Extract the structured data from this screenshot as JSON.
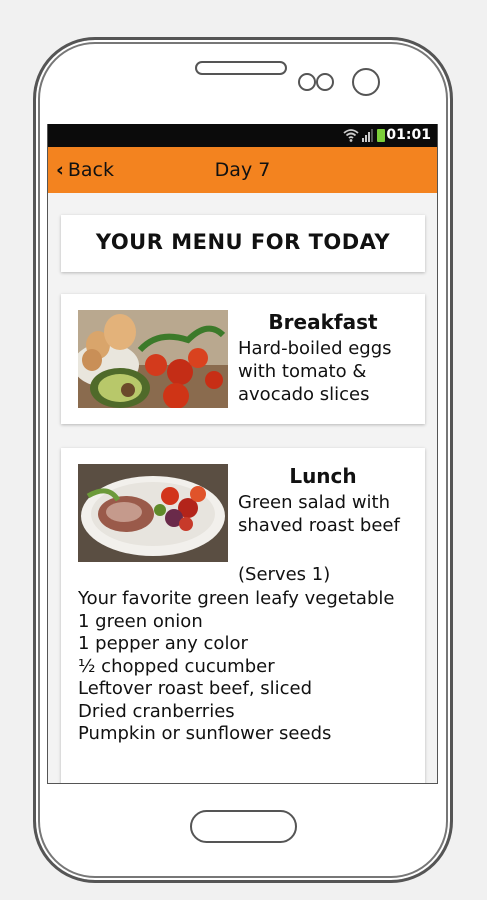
{
  "status_bar": {
    "time": "01:01"
  },
  "nav": {
    "back_label": "Back",
    "title": "Day 7"
  },
  "menu_title": "YOUR MENU FOR TODAY",
  "breakfast": {
    "name": "Breakfast",
    "description": "Hard-boiled eggs with tomato & avocado slices"
  },
  "lunch": {
    "name": "Lunch",
    "description": "Green salad with shaved roast beef",
    "serves": "(Serves 1)",
    "ingredients": [
      "Your favorite green leafy vegetable",
      "1 green onion",
      "1 pepper any color",
      "½ chopped cucumber",
      "Leftover roast beef, sliced",
      "Dried cranberries",
      "Pumpkin or sunflower seeds"
    ]
  },
  "colors": {
    "accent": "#f3831f",
    "status_bar": "#0b0b0b",
    "battery": "#7ccf3a"
  },
  "icons": [
    "wifi-icon",
    "signal-icon",
    "battery-icon",
    "chevron-left-icon"
  ]
}
